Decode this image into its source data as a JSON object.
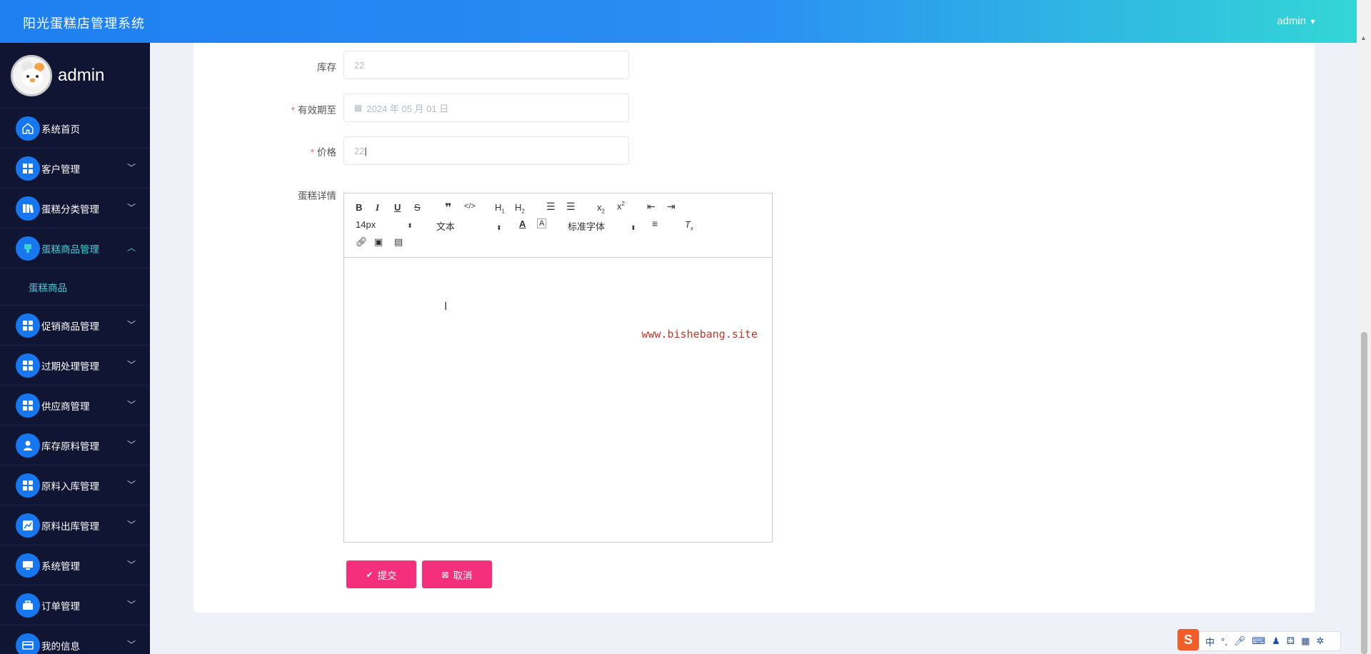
{
  "app": {
    "title": "阳光蛋糕店管理系统",
    "user": "admin"
  },
  "sidebar": {
    "profile_name": "admin",
    "items": [
      {
        "label": "系统首页",
        "icon": "home-icon",
        "expandable": false
      },
      {
        "label": "客户管理",
        "icon": "grid-icon",
        "expandable": true
      },
      {
        "label": "蛋糕分类管理",
        "icon": "book-icon",
        "expandable": true
      },
      {
        "label": "蛋糕商品管理",
        "icon": "cake-icon",
        "expandable": true,
        "expanded": true
      },
      {
        "label": "促销商品管理",
        "icon": "grid-icon",
        "expandable": true
      },
      {
        "label": "过期处理管理",
        "icon": "grid-icon",
        "expandable": true
      },
      {
        "label": "供应商管理",
        "icon": "grid-icon",
        "expandable": true
      },
      {
        "label": "库存原料管理",
        "icon": "user-icon",
        "expandable": true
      },
      {
        "label": "原料入库管理",
        "icon": "grid-icon",
        "expandable": true
      },
      {
        "label": "原料出库管理",
        "icon": "chart-icon",
        "expandable": true
      },
      {
        "label": "系统管理",
        "icon": "monitor-icon",
        "expandable": true
      },
      {
        "label": "订单管理",
        "icon": "briefcase-icon",
        "expandable": true
      },
      {
        "label": "我的信息",
        "icon": "card-icon",
        "expandable": true
      }
    ],
    "subitem": "蛋糕商品"
  },
  "form": {
    "stock": {
      "label": "库存",
      "value": "22",
      "required": false
    },
    "expiry": {
      "label": "有效期至",
      "value": "2024 年 05 月 01 日",
      "required": true
    },
    "price": {
      "label": "价格",
      "value": "22",
      "required": true
    },
    "details": {
      "label": "蛋糕详情",
      "required": false
    }
  },
  "editor": {
    "font_size": "14px",
    "text_type": "文本",
    "font_family": "标准字体",
    "watermark": "www.bishebang.site"
  },
  "buttons": {
    "submit": "提交",
    "cancel": "取消"
  },
  "colors": {
    "accent": "#1677ee",
    "sidebar_bg": "#0f1533",
    "active_text": "#3fd1d8",
    "button_pink": "#f52f7b"
  },
  "ime": {
    "logo": "S",
    "mode": "中"
  }
}
